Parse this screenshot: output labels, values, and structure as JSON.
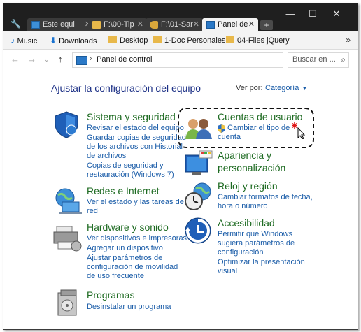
{
  "tabs": [
    {
      "label": "Este equi",
      "icon": "monitor-icon",
      "active": false
    },
    {
      "label": "F:\\00-Tip",
      "icon": "folder-icon",
      "active": false
    },
    {
      "label": "F:\\01-Sar",
      "icon": "key-icon",
      "active": false
    },
    {
      "label": "Panel de",
      "icon": "control-panel-icon",
      "active": true
    }
  ],
  "bookmarks": [
    {
      "label": "Music",
      "icon": "music-icon"
    },
    {
      "label": "Downloads",
      "icon": "download-icon"
    },
    {
      "label": "Desktop",
      "icon": "folder-icon"
    },
    {
      "label": "1-Doc Personales",
      "icon": "folder-icon"
    },
    {
      "label": "04-Files jQuery",
      "icon": "folder-icon"
    }
  ],
  "address": {
    "path": "Panel de control",
    "search_placeholder": "Buscar en ..."
  },
  "content": {
    "heading": "Ajustar la configuración del equipo",
    "viewby_label": "Ver por:",
    "viewby_value": "Categoría"
  },
  "items": {
    "sistema": {
      "title": "Sistema y seguridad",
      "links": [
        "Revisar el estado del equipo",
        "Guardar copias de seguridad",
        "de los archivos con Historial",
        "de archivos",
        "Copias de seguridad y",
        "restauración (Windows 7)"
      ]
    },
    "redes": {
      "title": "Redes e Internet",
      "links": [
        "Ver el estado y las tareas de",
        "red"
      ]
    },
    "hardware": {
      "title": "Hardware y sonido",
      "links": [
        "Ver dispositivos e impresoras",
        "Agregar un dispositivo",
        "Ajustar parámetros de",
        "configuración de movilidad",
        "de uso frecuente"
      ]
    },
    "programas": {
      "title": "Programas",
      "links": [
        "Desinstalar un programa"
      ]
    },
    "cuentas": {
      "title": "Cuentas de usuario",
      "links": [
        "Cambiar el tipo de",
        "cuenta"
      ]
    },
    "apariencia": {
      "title_line1": "Apariencia y",
      "title_line2": "personalización"
    },
    "reloj": {
      "title": "Reloj y región",
      "links": [
        "Cambiar formatos de fecha,",
        "hora o número"
      ]
    },
    "accesibilidad": {
      "title": "Accesibilidad",
      "links": [
        "Permitir que Windows",
        "sugiera parámetros de",
        "configuración",
        "Optimizar la presentación",
        "visual"
      ]
    }
  },
  "colors": {
    "link": "#1a5ca8",
    "category_title": "#1e6b22",
    "heading": "#1e3287",
    "titlebar": "#1f1f1f"
  }
}
